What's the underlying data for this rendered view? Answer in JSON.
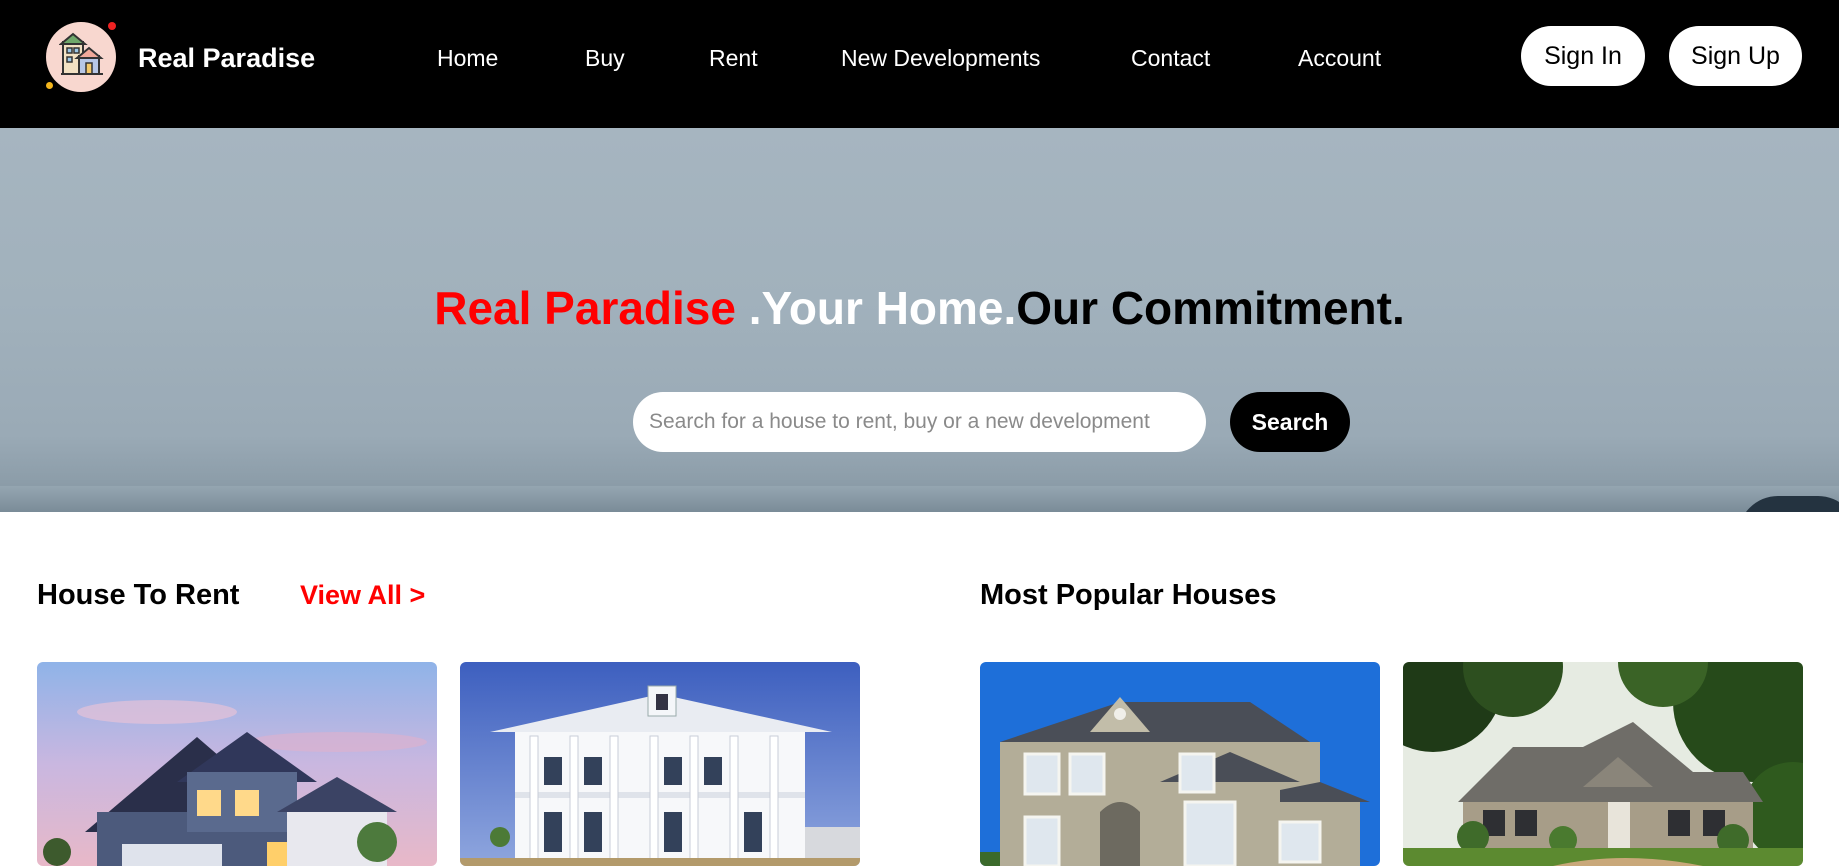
{
  "brand": {
    "name": "Real Paradise",
    "logo_icon": "house-logo-icon"
  },
  "nav": {
    "links": [
      "Home",
      "Buy",
      "Rent",
      "New Developments",
      "Contact",
      "Account"
    ],
    "sign_in": "Sign In",
    "sign_up": "Sign Up"
  },
  "hero": {
    "headline_red": "Real Paradise ",
    "headline_white": ".Your Home.",
    "headline_black": "Our Commitment.",
    "search_placeholder": "Search for a house to rent, buy or a new development",
    "search_button": "Search"
  },
  "rent_section": {
    "title": "House To Rent",
    "view_all": "View All >"
  },
  "popular_section": {
    "title": "Most Popular Houses"
  },
  "colors": {
    "accent_red": "#ff0000",
    "nav_bg": "#000000",
    "hero_bg": "#a6b5c0"
  }
}
